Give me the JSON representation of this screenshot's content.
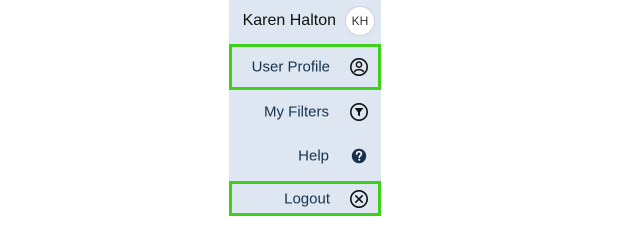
{
  "header": {
    "user_name": "Karen Halton",
    "avatar_initials": "KH"
  },
  "menu": {
    "items": [
      {
        "label": "User Profile",
        "icon": "user-profile-icon",
        "highlighted": true
      },
      {
        "label": "My Filters",
        "icon": "filter-icon",
        "highlighted": false
      },
      {
        "label": "Help",
        "icon": "help-icon",
        "highlighted": false
      },
      {
        "label": "Logout",
        "icon": "logout-icon",
        "highlighted": true
      }
    ]
  },
  "colors": {
    "panel_background": "#dde6f1",
    "text": "#17324d",
    "highlight_outline": "#3fd01c"
  }
}
